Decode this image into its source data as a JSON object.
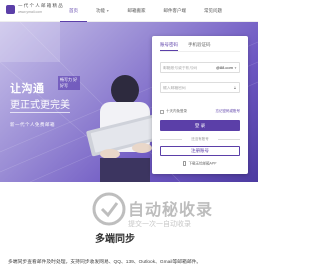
{
  "header": {
    "logo_line1": "一 代 个 人 邮 箱 精 品",
    "logo_line2": "www.ymail.com",
    "nav": [
      {
        "label": "首页",
        "active": true,
        "has_caret": false
      },
      {
        "label": "功能",
        "active": false,
        "has_caret": true
      },
      {
        "label": "邮箱搬家",
        "active": false,
        "has_caret": false
      },
      {
        "label": "邮件客户端",
        "active": false,
        "has_caret": false
      },
      {
        "label": "常见问题",
        "active": false,
        "has_caret": false
      }
    ]
  },
  "hero": {
    "slogan1": "让沟通",
    "slogan2": "更正式更完美",
    "side_text": "畅写力 好好写",
    "subtitle": "新一代个人免费邮箱"
  },
  "login": {
    "tabs": [
      {
        "label": "账号密码",
        "active": true
      },
      {
        "label": "手机验证码",
        "active": false
      }
    ],
    "account_placeholder": "邮箱账号或手机号码",
    "account_suffix": "@88.com",
    "password_placeholder": "输入邮箱密码",
    "remember_label": "十天内免登录",
    "forgot_label": "忘记密码或账号",
    "login_button": "登 录",
    "or_text": "还没有账号",
    "register_button": "注册账号",
    "app_link": "下载无忧邮箱APP"
  },
  "lower": {
    "section_title": "多端同步",
    "watermark_text": "自动秘收录",
    "watermark_sub": "提交一次一自动收录",
    "description": "多端同步查看邮件及时处理，支持同步收发网易、QQ、139、Outlook、Gmail等邮箱邮件。"
  },
  "colors": {
    "brand": "#5b3fa8",
    "hero_start": "#c9c2ea",
    "hero_end": "#4c3aa0"
  },
  "icons": [
    "logo-mark-icon",
    "lock-icon",
    "phone-icon",
    "watermark-logo-icon"
  ]
}
